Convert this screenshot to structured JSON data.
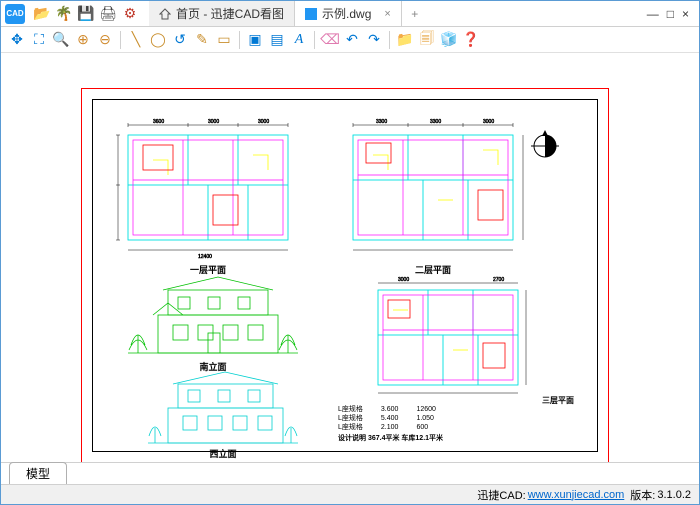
{
  "app": {
    "logo_text": "CAD"
  },
  "titlebar_icons": {
    "open": "open-icon",
    "palm": "palm-icon",
    "save": "save-icon",
    "print": "print-icon",
    "prefs": "prefs-icon"
  },
  "tabs": [
    {
      "label": "首页 - 迅捷CAD看图",
      "active": false,
      "closable": false
    },
    {
      "label": "示例.dwg",
      "active": true,
      "closable": true
    }
  ],
  "window_controls": {
    "minimize": "—",
    "maximize": "□",
    "close": "×"
  },
  "toolbar": {
    "groups": [
      [
        "pan-icon",
        "zoom-extents-icon",
        "zoom-window-icon",
        "zoom-in-icon",
        "zoom-out-icon"
      ],
      [
        "line-icon",
        "circle-icon",
        "arc-icon",
        "polyline-icon",
        "rectangle-icon"
      ],
      [
        "layer-icon",
        "layer-prev-icon",
        "text-icon"
      ],
      [
        "erase-icon",
        "undo-icon",
        "redo-icon"
      ],
      [
        "open2-icon",
        "save2-icon",
        "box-icon",
        "help-icon"
      ]
    ]
  },
  "drawings": {
    "plan1_caption": "一层平面",
    "plan2_caption": "二层平面",
    "elev1_caption": "南立面",
    "elev2_caption": "西立面",
    "plan3_caption": "三层平面"
  },
  "notes_block": "设计说明   367.4平米  车库12.1平米",
  "model_tab": "模型",
  "status": {
    "prefix": "迅捷CAD:",
    "link_text": "www.xunjiecad.com",
    "version_label": "版本:",
    "version": "3.1.0.2"
  }
}
